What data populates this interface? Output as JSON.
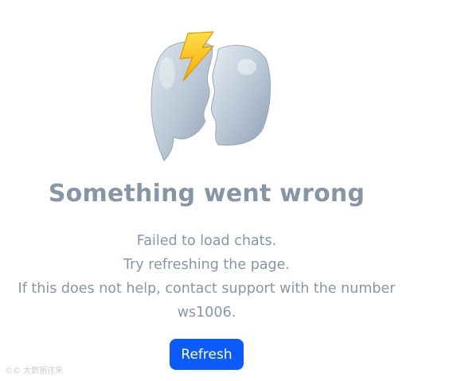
{
  "error": {
    "icon": "broken-chat-bubble-with-lightning-icon",
    "title": "Something went wrong",
    "message_lines": [
      "Failed to load chats.",
      "Try refreshing the page.",
      "If this does not help, contact support with the number",
      "ws1006."
    ],
    "refresh_label": "Refresh"
  },
  "watermark": "©© 大数据往来",
  "colors": {
    "text": "#8796a7",
    "button": "#0a5bf8",
    "button_text": "#ffffff",
    "background": "#ffffff"
  }
}
